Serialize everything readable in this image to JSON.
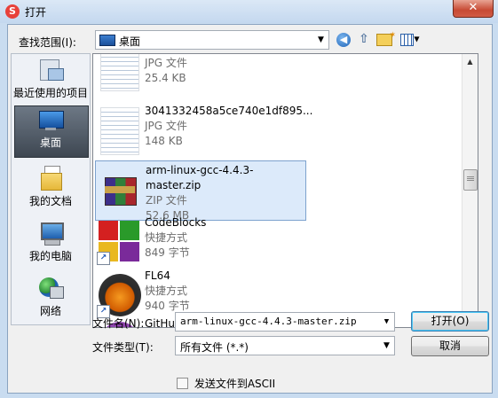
{
  "window": {
    "title": "打开",
    "close_glyph": "✕"
  },
  "toolbar": {
    "look_in_label": "查找范围(I):",
    "look_in_value": "桌面",
    "back_icon": "back-arrow-icon",
    "up_icon": "up-folder-icon",
    "new_folder_icon": "new-folder-icon",
    "view_menu_icon": "view-menu-icon"
  },
  "places": [
    {
      "label": "最近使用的项目",
      "icon": "recent-items-icon"
    },
    {
      "label": "桌面",
      "icon": "desktop-icon",
      "selected": true
    },
    {
      "label": "我的文档",
      "icon": "my-documents-icon"
    },
    {
      "label": "我的电脑",
      "icon": "my-computer-icon"
    },
    {
      "label": "网络",
      "icon": "network-icon"
    }
  ],
  "files": [
    {
      "name": "",
      "type": "JPG 文件",
      "size": "25.4 KB"
    },
    {
      "name": "3041332458a5ce740e1df895...",
      "type": "JPG 文件",
      "size": "148 KB"
    },
    {
      "name": "arm-linux-gcc-4.4.3-master.zip",
      "type": "ZIP 文件",
      "size": "52.6 MB",
      "selected": true
    },
    {
      "name": "CodeBlocks",
      "type": "快捷方式",
      "size": "849 字节"
    },
    {
      "name": "FL64",
      "type": "快捷方式",
      "size": "940 字节"
    },
    {
      "name": "GitHub Desktop",
      "type": "",
      "size": ""
    }
  ],
  "form": {
    "file_name_label": "文件名(N):",
    "file_name_value": "arm-linux-gcc-4.4.3-master.zip",
    "file_type_label": "文件类型(T):",
    "file_type_value": "所有文件 (*.*)",
    "open_button": "打开(O)",
    "cancel_button": "取消",
    "ascii_checkbox_label": "发送文件到ASCII",
    "ascii_checked": false
  }
}
